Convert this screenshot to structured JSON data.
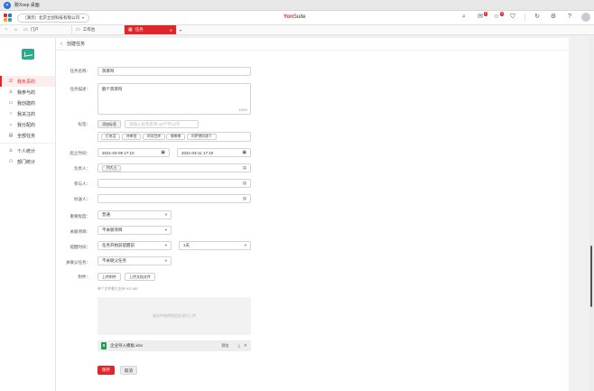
{
  "os": {
    "title": "致Xsep 桌面"
  },
  "header": {
    "company": "（演示）北京立创科技有限公司",
    "brand_main": "Yon",
    "brand_sub": "Suite",
    "msg_badge": "2",
    "notify_badge": "3"
  },
  "tabs": [
    {
      "label": "门户"
    },
    {
      "label": "工作台"
    },
    {
      "label": "任务"
    }
  ],
  "page": {
    "title": "创建任务"
  },
  "sidebar": {
    "items": [
      {
        "label": "我负责的",
        "icon": "☑"
      },
      {
        "label": "我参与的",
        "icon": "♙"
      },
      {
        "label": "我创建的",
        "icon": "▭"
      },
      {
        "label": "我关注的",
        "icon": "☆"
      },
      {
        "label": "我分配的",
        "icon": "⌂"
      },
      {
        "label": "全部任务",
        "icon": "▤"
      },
      {
        "label": "个人统计",
        "icon": "♙"
      },
      {
        "label": "部门统计",
        "icon": "⚇"
      }
    ]
  },
  "form": {
    "name_label": "任务名称：",
    "name_value": "筑草阿",
    "desc_label": "任务描述：",
    "desc_value": "额个筑草阿",
    "desc_counter": "6/500",
    "tag_label": "标签：",
    "add_tag_button": "添加标签",
    "tag_placeholder": "添加入标签名称 10个字以内",
    "tag_chips": [
      "打电话",
      "待审批",
      "的项目库",
      "哪哪哪",
      "阿萨德同源下"
    ],
    "time_label": "起止时间：",
    "start_time": "2021-03-09 17:10",
    "end_time": "2021-03-11 17:10",
    "owner_label": "负责人：",
    "owner_value": "何大土",
    "participant_label": "参与人：",
    "cc_label": "抄送人：",
    "priority_label": "重要程度：",
    "priority_value": "普通",
    "project_label": "关联项目：",
    "project_value": "不关联项目",
    "remind_label": "提醒时间：",
    "remind_value": "任务开始前提醒前",
    "remind_offset": "1天",
    "parent_label": "关联父任务：",
    "parent_value": "不关联父任务",
    "attach_label": "附件：",
    "upload_button": "上传附件",
    "upload_doc_button": "上传文档文件",
    "attach_hint": "单个文件最大支持 300 MB",
    "dropzone_hint": "请文件拖拽到此处进行上传",
    "file_name": "企业导入模板.xlsx",
    "preview_label": "预览",
    "save_button": "保存",
    "cancel_button": "取消"
  },
  "colors": {
    "accent": "#e0262b",
    "logo": "#2fa98c",
    "excel": "#1f9a4f"
  }
}
